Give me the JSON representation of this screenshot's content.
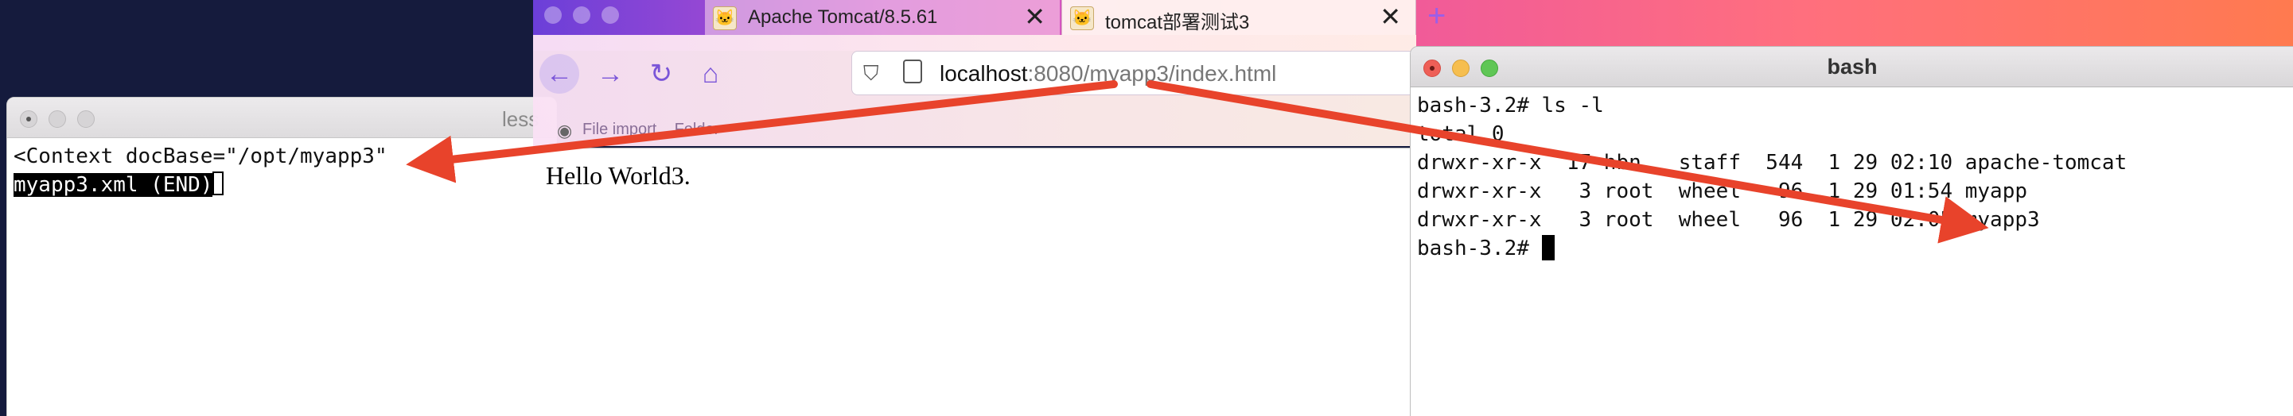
{
  "less_window": {
    "title": "less",
    "lines": [
      "<Context docBase=\"/opt/myapp3\"",
      "myapp3.xml (END)"
    ]
  },
  "browser": {
    "tabs": [
      {
        "label": "Apache Tomcat/8.5.61",
        "active": false
      },
      {
        "label": "tomcat部署测试3",
        "active": true
      }
    ],
    "new_tab": "+",
    "url_host": "localhost",
    "url_rest": ":8080/myapp3/index.html",
    "bookmark_text": "File import... Folder",
    "page_text": "Hello World3."
  },
  "bash_window": {
    "title": "bash",
    "lines": [
      "bash-3.2# ls -l",
      "total 0",
      "drwxr-xr-x  17 hbn   staff  544  1 29 02:10 apache-tomcat",
      "drwxr-xr-x   3 root  wheel   96  1 29 01:54 myapp",
      "drwxr-xr-x   3 root  wheel   96  1 29 02:05 myapp3"
    ],
    "prompt": "bash-3.2# "
  },
  "colors": {
    "arrow": "#e8432b",
    "accent": "#7a55d8"
  }
}
